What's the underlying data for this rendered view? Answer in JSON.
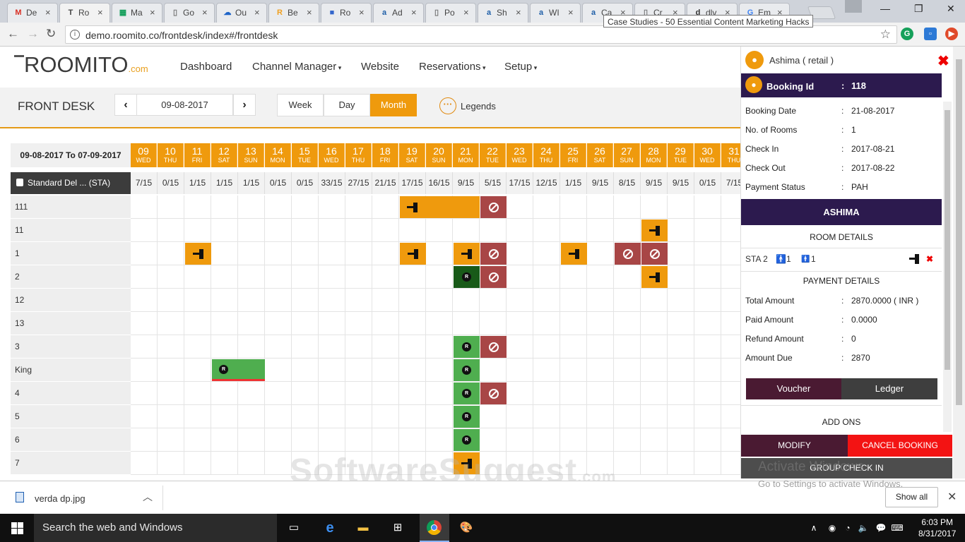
{
  "browser": {
    "tabs": [
      {
        "icon": "gmail-icon",
        "fav": "M",
        "favcolor": "#d93025",
        "title": "De"
      },
      {
        "icon": "roomito-icon",
        "fav": "T",
        "favcolor": "#444",
        "title": "Ro",
        "active": true
      },
      {
        "icon": "sheets-icon",
        "fav": "▦",
        "favcolor": "#0f9d58",
        "title": "Ma"
      },
      {
        "icon": "doc-icon",
        "fav": "▯",
        "favcolor": "#777",
        "title": "Go"
      },
      {
        "icon": "outlook-icon",
        "fav": "☁",
        "favcolor": "#1e64c8",
        "title": "Ou"
      },
      {
        "icon": "r-icon",
        "fav": "R",
        "favcolor": "#f0a020",
        "title": "Be"
      },
      {
        "icon": "rc-icon",
        "fav": "■",
        "favcolor": "#3366cc",
        "title": "Ro"
      },
      {
        "icon": "ad-icon",
        "fav": "a",
        "favcolor": "#1f5fa8",
        "title": "Ad"
      },
      {
        "icon": "doc-icon",
        "fav": "▯",
        "favcolor": "#777",
        "title": "Po"
      },
      {
        "icon": "ad-icon",
        "fav": "a",
        "favcolor": "#1f5fa8",
        "title": "Sh"
      },
      {
        "icon": "ad-icon",
        "fav": "a",
        "favcolor": "#1f5fa8",
        "title": "WI"
      },
      {
        "icon": "ad-icon",
        "fav": "a",
        "favcolor": "#1f5fa8",
        "title": "Ca"
      },
      {
        "icon": "doc-icon",
        "fav": "▯",
        "favcolor": "#777",
        "title": "Cr"
      },
      {
        "icon": "d-icon",
        "fav": "d",
        "favcolor": "#333",
        "title": "dlv"
      },
      {
        "icon": "google-icon",
        "fav": "G",
        "favcolor": "#4285f4",
        "title": "Em"
      }
    ],
    "tooltip": "Case Studies - 50 Essential Content Marketing Hacks",
    "url": "demo.roomito.co/frontdesk/index#/frontdesk"
  },
  "app": {
    "logo": "ROOMITO",
    "logo_suffix": ".com",
    "nav": [
      "Dashboard",
      "Channel Manager",
      "Website",
      "Reservations",
      "Setup"
    ]
  },
  "frontdesk": {
    "title": "FRONT DESK",
    "date": "09-08-2017",
    "views": [
      "Week",
      "Day",
      "Month"
    ],
    "active_view": "Month",
    "legends": "Legends",
    "date_range": "09-08-2017 To 07-09-2017",
    "days": [
      {
        "d": "09",
        "w": "WED"
      },
      {
        "d": "10",
        "w": "THU"
      },
      {
        "d": "11",
        "w": "FRI"
      },
      {
        "d": "12",
        "w": "SAT"
      },
      {
        "d": "13",
        "w": "SUN"
      },
      {
        "d": "14",
        "w": "MON"
      },
      {
        "d": "15",
        "w": "TUE"
      },
      {
        "d": "16",
        "w": "WED"
      },
      {
        "d": "17",
        "w": "THU"
      },
      {
        "d": "18",
        "w": "FRI"
      },
      {
        "d": "19",
        "w": "SAT"
      },
      {
        "d": "20",
        "w": "SUN"
      },
      {
        "d": "21",
        "w": "MON"
      },
      {
        "d": "22",
        "w": "TUE"
      },
      {
        "d": "23",
        "w": "WED"
      },
      {
        "d": "24",
        "w": "THU"
      },
      {
        "d": "25",
        "w": "FRI"
      },
      {
        "d": "26",
        "w": "SAT"
      },
      {
        "d": "27",
        "w": "SUN"
      },
      {
        "d": "28",
        "w": "MON"
      },
      {
        "d": "29",
        "w": "TUE"
      },
      {
        "d": "30",
        "w": "WED"
      },
      {
        "d": "31",
        "w": "THU"
      }
    ],
    "room_type": "Standard Del ... (STA)",
    "availability": [
      "7/15",
      "0/15",
      "1/15",
      "1/15",
      "1/15",
      "0/15",
      "0/15",
      "33/15",
      "27/15",
      "21/15",
      "17/15",
      "16/15",
      "9/15",
      "5/15",
      "17/15",
      "12/15",
      "1/15",
      "9/15",
      "8/15",
      "9/15",
      "9/15",
      "0/15",
      "7/15"
    ],
    "rooms": [
      "111",
      "11",
      "1",
      "2",
      "12",
      "13",
      "3",
      "King",
      "4",
      "5",
      "6",
      "7"
    ],
    "bookings": [
      {
        "room": 0,
        "start": 10,
        "len": 3,
        "color": "or",
        "icon": "exit"
      },
      {
        "room": 0,
        "start": 13,
        "len": 1,
        "color": "rd",
        "icon": "noentry"
      },
      {
        "room": 1,
        "start": 19,
        "len": 1,
        "color": "or",
        "icon": "exit"
      },
      {
        "room": 2,
        "start": 2,
        "len": 1,
        "color": "or",
        "icon": "exit"
      },
      {
        "room": 2,
        "start": 10,
        "len": 1,
        "color": "or",
        "icon": "exit"
      },
      {
        "room": 2,
        "start": 12,
        "len": 1,
        "color": "or",
        "icon": "exit"
      },
      {
        "room": 2,
        "start": 13,
        "len": 1,
        "color": "rd",
        "icon": "noentry"
      },
      {
        "room": 2,
        "start": 16,
        "len": 1,
        "color": "or",
        "icon": "exit"
      },
      {
        "room": 2,
        "start": 18,
        "len": 1,
        "color": "rd",
        "icon": "noentry"
      },
      {
        "room": 2,
        "start": 19,
        "len": 1,
        "color": "rd",
        "icon": "noentry"
      },
      {
        "room": 3,
        "start": 12,
        "len": 1,
        "color": "dg",
        "icon": "R"
      },
      {
        "room": 3,
        "start": 13,
        "len": 1,
        "color": "rd",
        "icon": "noentry"
      },
      {
        "room": 3,
        "start": 19,
        "len": 1,
        "color": "or",
        "icon": "exit"
      },
      {
        "room": 6,
        "start": 12,
        "len": 1,
        "color": "gr",
        "icon": "R"
      },
      {
        "room": 6,
        "start": 13,
        "len": 1,
        "color": "rd",
        "icon": "noentry"
      },
      {
        "room": 7,
        "start": 3,
        "len": 2,
        "color": "gr",
        "icon": "R",
        "underline": true
      },
      {
        "room": 7,
        "start": 12,
        "len": 1,
        "color": "gr",
        "icon": "R"
      },
      {
        "room": 8,
        "start": 12,
        "len": 1,
        "color": "gr",
        "icon": "R"
      },
      {
        "room": 8,
        "start": 13,
        "len": 1,
        "color": "rd",
        "icon": "noentry"
      },
      {
        "room": 9,
        "start": 12,
        "len": 1,
        "color": "gr",
        "icon": "R"
      },
      {
        "room": 10,
        "start": 12,
        "len": 1,
        "color": "gr",
        "icon": "R"
      },
      {
        "room": 11,
        "start": 12,
        "len": 1,
        "color": "or",
        "icon": "exit"
      }
    ],
    "watermark": "SoftwareSuggest",
    "watermark_suffix": ".com"
  },
  "panel": {
    "guest": "Ashima ( retail )",
    "booking_id_label": "Booking Id",
    "booking_id": "118",
    "details": [
      {
        "label": "Booking Date",
        "value": "21-08-2017"
      },
      {
        "label": "No. of Rooms",
        "value": "1"
      },
      {
        "label": "Check In",
        "value": "2017-08-21"
      },
      {
        "label": "Check Out",
        "value": "2017-08-22"
      },
      {
        "label": "Payment Status",
        "value": "PAH"
      }
    ],
    "guest_bar": "ASHIMA",
    "room_details": "ROOM DETAILS",
    "room_line": {
      "room": "STA 2",
      "adults": "1",
      "children": "1"
    },
    "payment_details": "PAYMENT DETAILS",
    "payments": [
      {
        "label": "Total Amount",
        "value": "2870.0000 ( INR )"
      },
      {
        "label": "Paid Amount",
        "value": "0.0000"
      },
      {
        "label": "Refund Amount",
        "value": "0"
      },
      {
        "label": "Amount Due",
        "value": "2870"
      }
    ],
    "voucher": "Voucher",
    "ledger": "Ledger",
    "add_ons": "ADD ONS",
    "modify": "MODIFY",
    "cancel": "CANCEL BOOKING",
    "group_checkin": "GROUP CHECK IN"
  },
  "os": {
    "activate_title": "Activate Windows",
    "activate_sub": "Go to Settings to activate Windows.",
    "download_file": "verda dp.jpg",
    "show_all": "Show all",
    "search": "Search the web and Windows",
    "time": "6:03 PM",
    "date": "8/31/2017"
  }
}
